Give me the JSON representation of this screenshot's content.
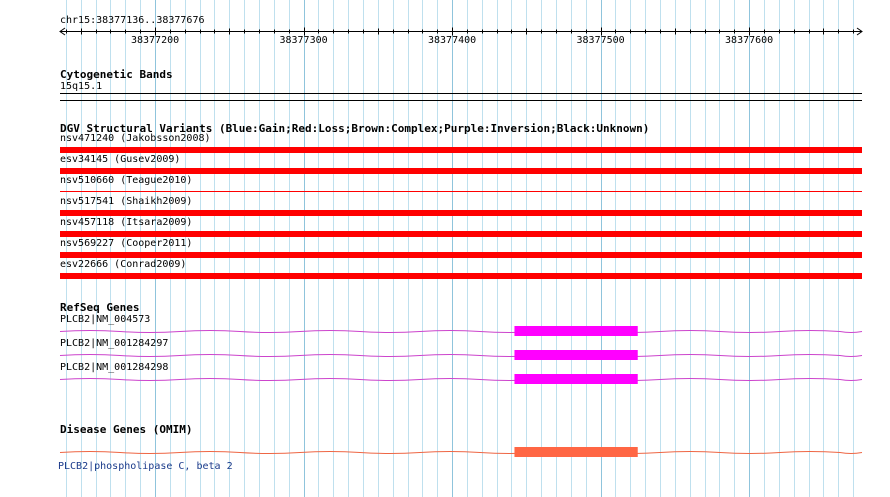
{
  "ruler": {
    "location": "chr15:38377136..38377676",
    "start": 38377136,
    "end": 38377676,
    "ticks": [
      {
        "pos": 38377200,
        "label": "38377200"
      },
      {
        "pos": 38377300,
        "label": "38377300"
      },
      {
        "pos": 38377400,
        "label": "38377400"
      },
      {
        "pos": 38377500,
        "label": "38377500"
      },
      {
        "pos": 38377600,
        "label": "38377600"
      }
    ]
  },
  "tracks": {
    "cytobands": {
      "title": "Cytogenetic Bands",
      "band": "15q15.1"
    },
    "dgv": {
      "title": "DGV Structural Variants (Blue:Gain;Red:Loss;Brown:Complex;Purple:Inversion;Black:Unknown)",
      "color": "#ff0000",
      "variants": [
        {
          "label": "nsv471240 (Jakobsson2008)",
          "type": "Loss",
          "thick": true
        },
        {
          "label": "esv34145 (Gusev2009)",
          "type": "Loss",
          "thick": true
        },
        {
          "label": "nsv510660 (Teague2010)",
          "type": "Loss",
          "thick": false
        },
        {
          "label": "nsv517541 (Shaikh2009)",
          "type": "Loss",
          "thick": true
        },
        {
          "label": "nsv457118 (Itsara2009)",
          "type": "Loss",
          "thick": true
        },
        {
          "label": "nsv569227 (Cooper2011)",
          "type": "Loss",
          "thick": true
        },
        {
          "label": "esv22666 (Conrad2009)",
          "type": "Loss",
          "thick": true
        }
      ]
    },
    "refseq": {
      "title": "RefSeq Genes",
      "intron_color": "#cc44cc",
      "exon_color": "#ff00ff",
      "exon": {
        "start": 38377442,
        "end": 38377525
      },
      "genes": [
        {
          "label": "PLCB2|NM_004573"
        },
        {
          "label": "PLCB2|NM_001284297"
        },
        {
          "label": "PLCB2|NM_001284298"
        }
      ]
    },
    "omim": {
      "title": "Disease Genes (OMIM)",
      "line_color": "#ee6644",
      "block_color": "#ff6644",
      "exon": {
        "start": 38377442,
        "end": 38377525
      },
      "gene_label": "PLCB2|phospholipase C, beta 2"
    }
  },
  "colors": {
    "grid_minor": "#bfe0ee",
    "grid_major": "#8fc4dc",
    "axis": "#000000"
  }
}
